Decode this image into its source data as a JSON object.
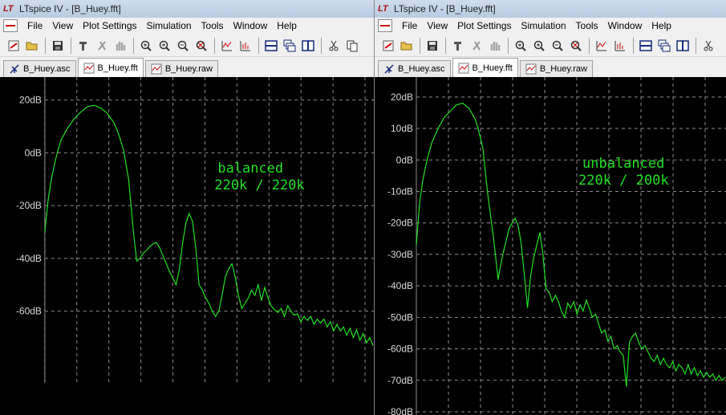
{
  "windows": [
    {
      "id": "left",
      "title": "LTspice IV - [B_Huey.fft]",
      "menu": [
        "File",
        "View",
        "Plot Settings",
        "Simulation",
        "Tools",
        "Window",
        "Help"
      ],
      "tabs": [
        {
          "label": "B_Huey.asc",
          "icon": "schematic-icon",
          "active": false
        },
        {
          "label": "B_Huey.fft",
          "icon": "waveform-icon",
          "active": true
        },
        {
          "label": "B_Huey.raw",
          "icon": "waveform-icon",
          "active": false
        }
      ],
      "annotation": {
        "line1": "balanced",
        "line2": "220k / 220k"
      }
    },
    {
      "id": "right",
      "title": "LTspice IV - [B_Huey.fft]",
      "menu": [
        "File",
        "View",
        "Plot Settings",
        "Simulation",
        "Tools",
        "Window",
        "Help"
      ],
      "tabs": [
        {
          "label": "B_Huey.asc",
          "icon": "schematic-icon",
          "active": false
        },
        {
          "label": "B_Huey.fft",
          "icon": "waveform-icon",
          "active": true
        },
        {
          "label": "B_Huey.raw",
          "icon": "waveform-icon",
          "active": false
        }
      ],
      "annotation": {
        "line1": "unbalanced",
        "line2": "220k / 200k"
      }
    }
  ],
  "colors": {
    "trace": "#22e022",
    "grid": "#8c8c8c",
    "background": "#000000",
    "tick_text": "#d8d8d8"
  },
  "chart_data": [
    {
      "type": "line",
      "title": "",
      "xlabel": "",
      "ylabel": "",
      "yunit": "dB",
      "ylim": [
        -75,
        22
      ],
      "yticks": [
        20,
        0,
        -20,
        -40,
        -60
      ],
      "ytick_labels": [
        "20dB",
        "0dB",
        "-20dB",
        "-40dB",
        "-60dB"
      ],
      "grid": true,
      "series": [
        {
          "x": [
            0,
            0.01,
            0.02,
            0.03,
            0.04,
            0.05,
            0.07,
            0.09,
            0.11,
            0.13,
            0.15,
            0.17,
            0.19,
            0.21,
            0.225,
            0.24,
            0.255,
            0.27,
            0.28,
            0.29,
            0.295,
            0.3,
            0.31,
            0.32,
            0.33,
            0.34,
            0.35,
            0.36,
            0.38,
            0.4,
            0.41,
            0.42,
            0.43,
            0.44,
            0.45,
            0.46,
            0.47,
            0.48,
            0.49,
            0.5,
            0.51,
            0.52,
            0.53,
            0.54,
            0.55,
            0.56,
            0.57,
            0.58,
            0.59,
            0.6,
            0.61,
            0.62,
            0.63,
            0.64,
            0.65,
            0.66,
            0.67,
            0.68,
            0.69,
            0.7,
            0.71,
            0.72,
            0.73,
            0.74,
            0.75,
            0.76,
            0.77,
            0.78,
            0.79,
            0.8,
            0.81,
            0.82,
            0.83,
            0.84,
            0.85,
            0.86,
            0.87,
            0.88,
            0.89,
            0.9,
            0.91,
            0.92,
            0.93,
            0.94,
            0.95,
            0.96,
            0.97,
            0.98,
            0.99,
            1.0
          ],
          "values": [
            -30,
            -18,
            -10,
            -4,
            1,
            5,
            9.5,
            13,
            15.5,
            17.5,
            18,
            17,
            15,
            11.5,
            7,
            1,
            -10,
            -30,
            -41,
            -40,
            -39,
            -38,
            -37,
            -35.5,
            -34.5,
            -34,
            -36,
            -39,
            -45,
            -50,
            -44,
            -34,
            -26.5,
            -23,
            -26,
            -36,
            -50,
            -52,
            -55,
            -57,
            -60,
            -62,
            -60,
            -54,
            -47,
            -44,
            -42,
            -47,
            -54,
            -59,
            -57,
            -55,
            -52,
            -54,
            -50,
            -56,
            -51,
            -55,
            -58,
            -59.5,
            -60.5,
            -59,
            -62,
            -58,
            -60,
            -61.5,
            -61,
            -64,
            -62,
            -63.5,
            -62,
            -65,
            -63,
            -64.5,
            -63,
            -66,
            -64,
            -67.5,
            -65,
            -67.5,
            -66,
            -69,
            -66.5,
            -70,
            -67,
            -71,
            -68.5,
            -72,
            -70,
            -73
          ]
        }
      ]
    },
    {
      "type": "line",
      "title": "",
      "xlabel": "",
      "ylabel": "",
      "yunit": "dB",
      "ylim": [
        -80,
        22
      ],
      "yticks": [
        20,
        10,
        0,
        -10,
        -20,
        -30,
        -40,
        -50,
        -60,
        -70,
        -80
      ],
      "ytick_labels": [
        "20dB",
        "10dB",
        "0dB",
        "-10dB",
        "-20dB",
        "-30dB",
        "-40dB",
        "-50dB",
        "-60dB",
        "-70dB",
        "-80dB"
      ],
      "grid": true,
      "series": [
        {
          "x": [
            0,
            0.01,
            0.02,
            0.03,
            0.04,
            0.05,
            0.07,
            0.09,
            0.11,
            0.13,
            0.15,
            0.17,
            0.19,
            0.2,
            0.215,
            0.23,
            0.25,
            0.265,
            0.27,
            0.28,
            0.29,
            0.3,
            0.31,
            0.32,
            0.33,
            0.34,
            0.35,
            0.36,
            0.37,
            0.38,
            0.39,
            0.4,
            0.41,
            0.42,
            0.43,
            0.44,
            0.45,
            0.46,
            0.47,
            0.48,
            0.49,
            0.5,
            0.51,
            0.52,
            0.53,
            0.54,
            0.55,
            0.56,
            0.57,
            0.58,
            0.59,
            0.6,
            0.61,
            0.62,
            0.63,
            0.64,
            0.65,
            0.66,
            0.67,
            0.68,
            0.69,
            0.7,
            0.71,
            0.72,
            0.73,
            0.74,
            0.75,
            0.76,
            0.77,
            0.78,
            0.79,
            0.8,
            0.81,
            0.82,
            0.83,
            0.84,
            0.85,
            0.86,
            0.87,
            0.88,
            0.89,
            0.9,
            0.91,
            0.92,
            0.93,
            0.94,
            0.95,
            0.96,
            0.97,
            0.98,
            0.99,
            1.0
          ],
          "values": [
            -27,
            -14,
            -7,
            -2,
            2,
            5.5,
            10,
            13.5,
            15.5,
            17.5,
            18,
            16.5,
            13,
            10,
            4,
            -10,
            -25,
            -38,
            -35,
            -30,
            -26,
            -22,
            -20,
            -18.5,
            -21,
            -27,
            -37,
            -47,
            -37,
            -31,
            -27,
            -23,
            -30,
            -41,
            -42,
            -45,
            -43,
            -45,
            -48,
            -50,
            -45.5,
            -47,
            -45,
            -49,
            -46,
            -48,
            -44.5,
            -47,
            -50,
            -49,
            -52,
            -55,
            -54,
            -57.5,
            -56,
            -60,
            -59,
            -61,
            -62,
            -72,
            -58,
            -56,
            -55,
            -58,
            -60,
            -59,
            -61,
            -63,
            -64,
            -62,
            -65,
            -63,
            -65,
            -66,
            -64,
            -67,
            -65,
            -66,
            -68,
            -65,
            -68,
            -66,
            -68.5,
            -67,
            -69,
            -67.5,
            -69,
            -68,
            -70,
            -68.5,
            -70,
            -69
          ]
        }
      ]
    }
  ]
}
